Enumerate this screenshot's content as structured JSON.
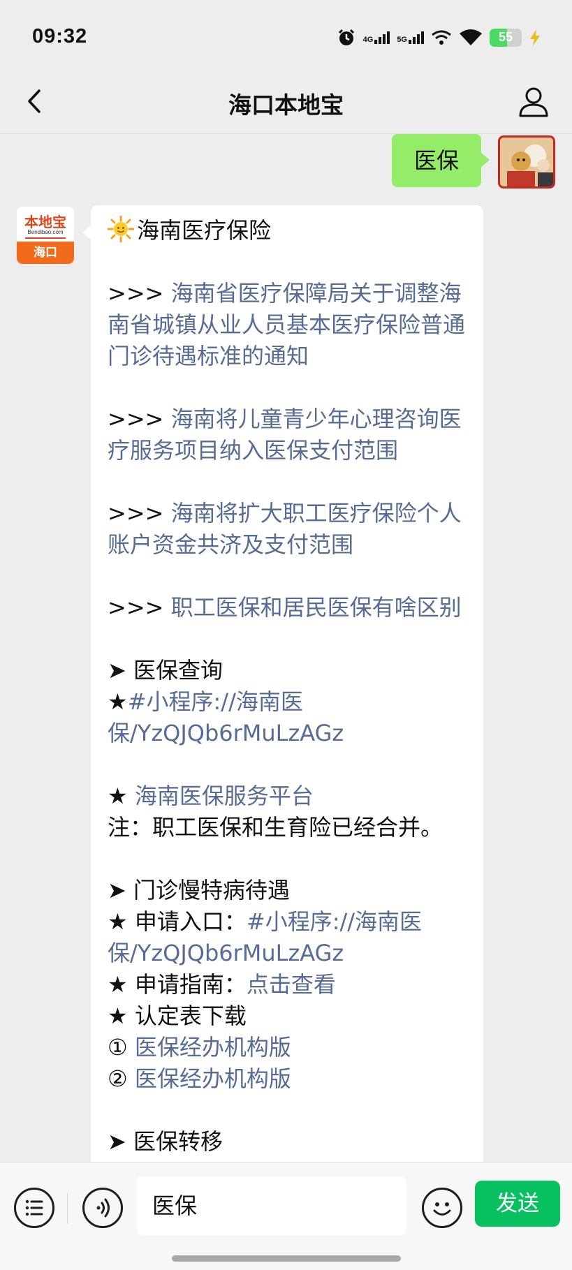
{
  "status_bar": {
    "time": "09:32",
    "network_1": "4G",
    "network_2": "5G",
    "battery_level": "55",
    "battery_fraction": 0.55,
    "battery_color": "#4cd964"
  },
  "nav": {
    "back_icon": "chevron-left-icon",
    "title": "海口本地宝",
    "profile_icon": "person-icon"
  },
  "chat": {
    "user_message": "医保",
    "bot_avatar": {
      "brand": "本地宝",
      "domain": "Bendibao.com",
      "city": "海口"
    },
    "bot_message": {
      "title": "海南医疗保险",
      "arrows": ">>> ",
      "links": [
        "海南省医疗保障局关于调整海南省城镇从业人员基本医疗保险普通门诊待遇标准的通知",
        "海南将儿童青少年心理咨询医疗服务项目纳入医保支付范围",
        "海南将扩大职工医疗保险个人账户资金共济及支付范围",
        "职工医保和居民医保有啥区别"
      ],
      "section_query": "➤ 医保查询",
      "star": "★",
      "query_mini_program": "#小程序://海南医保/YzQJQb6rMuLzAGz",
      "star_space": "★ ",
      "service_platform": "海南医保服务平台",
      "note": "注：职工医保和生育险已经合并。",
      "section_outpatient": "➤ 门诊慢特病待遇",
      "apply_entry_label": "★ 申请入口：",
      "apply_entry_link": "#小程序://海南医保/YzQJQb6rMuLzAGz",
      "guide_label": "★ 申请指南：",
      "guide_link": "点击查看",
      "download_label": "★ 认定表下载",
      "circle_1": "① ",
      "form_1": "医保经办机构版",
      "circle_2": "② ",
      "form_2": "医保经办机构版",
      "section_transfer": "➤ 医保转移"
    }
  },
  "input_bar": {
    "menu_icon": "menu-list-icon",
    "voice_icon": "voice-icon",
    "input_value": "医保",
    "emoji_icon": "emoji-icon",
    "send_label": "发送",
    "send_color": "#07c160"
  }
}
